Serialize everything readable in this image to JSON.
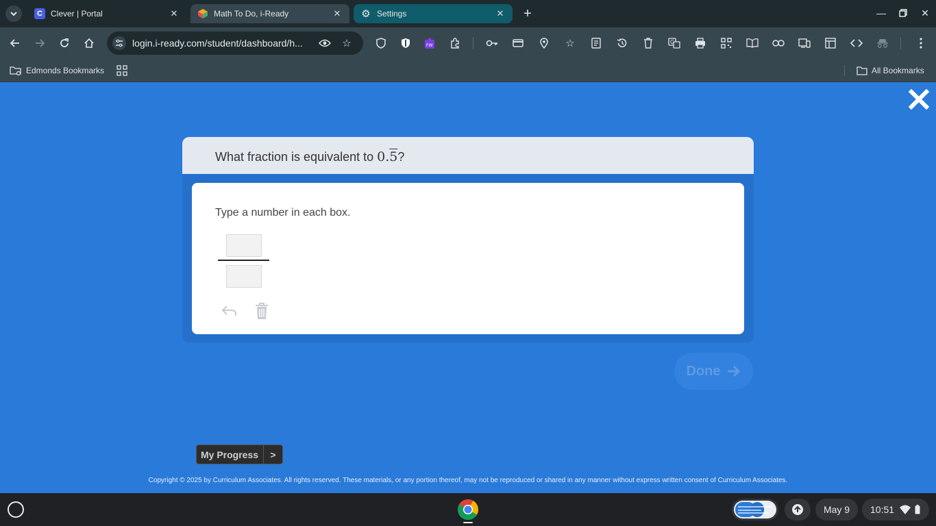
{
  "browser": {
    "tabs": [
      {
        "title": "Clever | Portal",
        "favicon": "C"
      },
      {
        "title": "Math To Do, i-Ready"
      },
      {
        "title": "Settings"
      }
    ],
    "url": "login.i-ready.com/student/dashboard/h...",
    "bookmarks": {
      "left": "Edmonds Bookmarks",
      "right": "All Bookmarks"
    }
  },
  "question": {
    "prefix": "What fraction is equivalent to ",
    "math_whole": "0.",
    "math_repeat": "5",
    "suffix": "?"
  },
  "answer": {
    "instruction": "Type a number in each box.",
    "numerator": "",
    "denominator": ""
  },
  "done_label": "Done",
  "progress": {
    "label": "My Progress",
    "arrow": ">"
  },
  "copyright": "Copyright © 2025 by Curriculum Associates. All rights reserved. These materials, or any portion thereof, may not be reproduced or shared in any manner without express written consent of Curriculum Associates.",
  "shelf": {
    "date": "May 9",
    "time": "10:51"
  },
  "colors": {
    "page_bg": "#2a7ad9",
    "question_bg": "#e4e9f0",
    "chrome_dark": "#1f2a2e",
    "chrome_toolbar": "#37474f",
    "settings_tab": "#0f5c6b"
  }
}
